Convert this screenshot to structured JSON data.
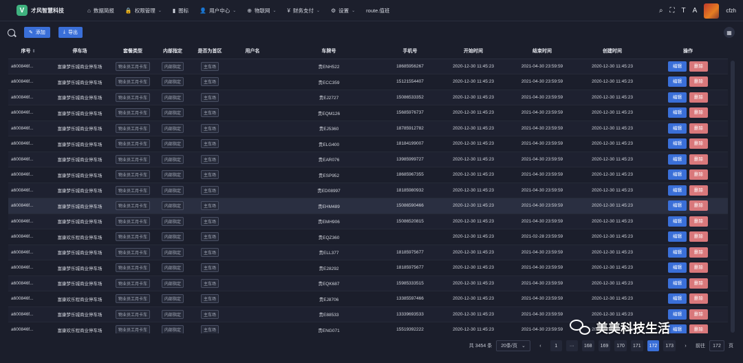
{
  "brand": {
    "logo_letter": "V",
    "name": "才风智慧科技"
  },
  "nav": [
    {
      "icon": "dashboard-icon",
      "glyph": "⌂",
      "label": "数据简报",
      "dropdown": false
    },
    {
      "icon": "lock-icon",
      "glyph": "🔒",
      "label": "权限管理",
      "dropdown": true
    },
    {
      "icon": "chart-icon",
      "glyph": "▮",
      "label": "图标",
      "dropdown": false
    },
    {
      "icon": "user-icon",
      "glyph": "👤",
      "label": "用户中心",
      "dropdown": true
    },
    {
      "icon": "iot-icon",
      "glyph": "⊕",
      "label": "物联网",
      "dropdown": true
    },
    {
      "icon": "yen-icon",
      "glyph": "¥",
      "label": "财务支付",
      "dropdown": true
    },
    {
      "icon": "settings-icon",
      "glyph": "⚙",
      "label": "设置",
      "dropdown": true
    },
    {
      "icon": "",
      "glyph": "",
      "label": "route.值班",
      "dropdown": false
    }
  ],
  "user": {
    "name": "cfzh"
  },
  "toolbar": {
    "add_label": "添加",
    "export_label": "导出",
    "add_glyph": "✎",
    "export_glyph": "⤓"
  },
  "table": {
    "headers": [
      "序号",
      "停车场",
      "套餐类型",
      "内部指定",
      "是否为首区",
      "用户名",
      "车牌号",
      "手机号",
      "开始时间",
      "结束时间",
      "创建时间",
      "操作"
    ],
    "tags": {
      "package": "物业员工月卡车",
      "internal": "内部指定",
      "primary": "主车场"
    },
    "actions": {
      "edit": "编辑",
      "delete": "删除"
    },
    "rows": [
      {
        "id": "a600846f...",
        "lot": "富康梦乐城商业停车场",
        "plate": "贵ENH522",
        "phone": "18685956267",
        "start": "2020-12-30 11:45:23",
        "end": "2021-04-30 23:59:59",
        "created": "2020-12-30 11:45:23"
      },
      {
        "id": "a600846f...",
        "lot": "富康梦乐城商业停车场",
        "plate": "贵ECC359",
        "phone": "15121554407",
        "start": "2020-12-30 11:45:23",
        "end": "2021-04-30 23:59:59",
        "created": "2020-12-30 11:45:23"
      },
      {
        "id": "a600846f...",
        "lot": "富康梦乐城商业停车场",
        "plate": "贵EJ2727",
        "phone": "15086533352",
        "start": "2020-12-30 11:45:23",
        "end": "2021-04-30 23:59:59",
        "created": "2020-12-30 11:45:23"
      },
      {
        "id": "a600846f...",
        "lot": "富康梦乐城商业停车场",
        "plate": "贵EQM126",
        "phone": "15685976737",
        "start": "2020-12-30 11:45:23",
        "end": "2021-04-30 23:59:59",
        "created": "2020-12-30 11:45:23"
      },
      {
        "id": "a600846f...",
        "lot": "富康梦乐城商业停车场",
        "plate": "贵EJ5360",
        "phone": "18785912782",
        "start": "2020-12-30 11:45:23",
        "end": "2021-04-30 23:59:59",
        "created": "2020-12-30 11:45:23"
      },
      {
        "id": "a600846f...",
        "lot": "富康梦乐城商业停车场",
        "plate": "贵ELG400",
        "phone": "18184199007",
        "start": "2020-12-30 11:45:23",
        "end": "2021-04-30 23:59:59",
        "created": "2020-12-30 11:45:23"
      },
      {
        "id": "a600846f...",
        "lot": "富康梦乐城商业停车场",
        "plate": "贵EAR076",
        "phone": "13985999727",
        "start": "2020-12-30 11:45:23",
        "end": "2021-04-30 23:59:59",
        "created": "2020-12-30 11:45:23"
      },
      {
        "id": "a600846f...",
        "lot": "富康梦乐城商业停车场",
        "plate": "贵ESP952",
        "phone": "18685967355",
        "start": "2020-12-30 11:45:23",
        "end": "2021-04-30 23:59:59",
        "created": "2020-12-30 11:45:23"
      },
      {
        "id": "a600846f...",
        "lot": "富康梦乐城商业停车场",
        "plate": "贵ED08997",
        "phone": "18185980932",
        "start": "2020-12-30 11:45:23",
        "end": "2021-04-30 23:59:59",
        "created": "2020-12-30 11:45:23"
      },
      {
        "id": "a600846f...",
        "lot": "富康梦乐城商业停车场",
        "plate": "贵EHM489",
        "phone": "15086590466",
        "start": "2020-12-30 11:45:23",
        "end": "2021-04-30 23:59:59",
        "created": "2020-12-30 11:45:23"
      },
      {
        "id": "a600846f...",
        "lot": "富康梦乐城商业停车场",
        "plate": "贵EMH906",
        "phone": "15086520815",
        "start": "2020-12-30 11:45:23",
        "end": "2021-04-30 23:59:59",
        "created": "2020-12-30 11:45:23"
      },
      {
        "id": "a600846f...",
        "lot": "富康欢乐程商业停车场",
        "plate": "贵EQZ360",
        "phone": "",
        "start": "2020-12-30 11:45:23",
        "end": "2021-02-28 23:59:59",
        "created": "2020-12-30 11:45:23"
      },
      {
        "id": "a600846f...",
        "lot": "富康梦乐城商业停车场",
        "plate": "贵ELL377",
        "phone": "18185975677",
        "start": "2020-12-30 11:45:23",
        "end": "2021-04-30 23:59:59",
        "created": "2020-12-30 11:45:23"
      },
      {
        "id": "a600846f...",
        "lot": "富康梦乐城商业停车场",
        "plate": "贵E28292",
        "phone": "18185975677",
        "start": "2020-12-30 11:45:23",
        "end": "2021-04-30 23:59:59",
        "created": "2020-12-30 11:45:23"
      },
      {
        "id": "a600846f...",
        "lot": "富康梦乐城商业停车场",
        "plate": "贵EQK687",
        "phone": "15985333515",
        "start": "2020-12-30 11:45:23",
        "end": "2021-04-30 23:59:59",
        "created": "2020-12-30 11:45:23"
      },
      {
        "id": "a600846f...",
        "lot": "富康欢乐程商业停车场",
        "plate": "贵EJ8706",
        "phone": "13385597466",
        "start": "2020-12-30 11:45:23",
        "end": "2021-04-30 23:59:59",
        "created": "2020-12-30 11:45:23"
      },
      {
        "id": "a600846f...",
        "lot": "富康梦乐城商业停车场",
        "plate": "贵E88533",
        "phone": "13339693533",
        "start": "2020-12-30 11:45:23",
        "end": "2021-04-30 23:59:59",
        "created": "2020-12-30 11:45:23"
      },
      {
        "id": "a600846f...",
        "lot": "富康欢乐程商业停车场",
        "plate": "贵ENG071",
        "phone": "15519392222",
        "start": "2020-12-30 11:45:23",
        "end": "2021-04-30 23:59:59",
        "created": "2020-12-30 11:45:23"
      }
    ],
    "highlighted_row": 9
  },
  "pagination": {
    "total": "共 3454 条",
    "page_size": "20条/页",
    "first": "1",
    "ellipsis": "···",
    "pages": [
      "168",
      "169",
      "170",
      "171",
      "172",
      "173"
    ],
    "current": "172",
    "goto_label": "前往",
    "goto_value": "172",
    "page_unit": "页"
  },
  "watermark": "美美科技生活",
  "colors": {
    "accent": "#3a6fd8",
    "danger": "#d9787b",
    "background": "#1b1e2b"
  }
}
